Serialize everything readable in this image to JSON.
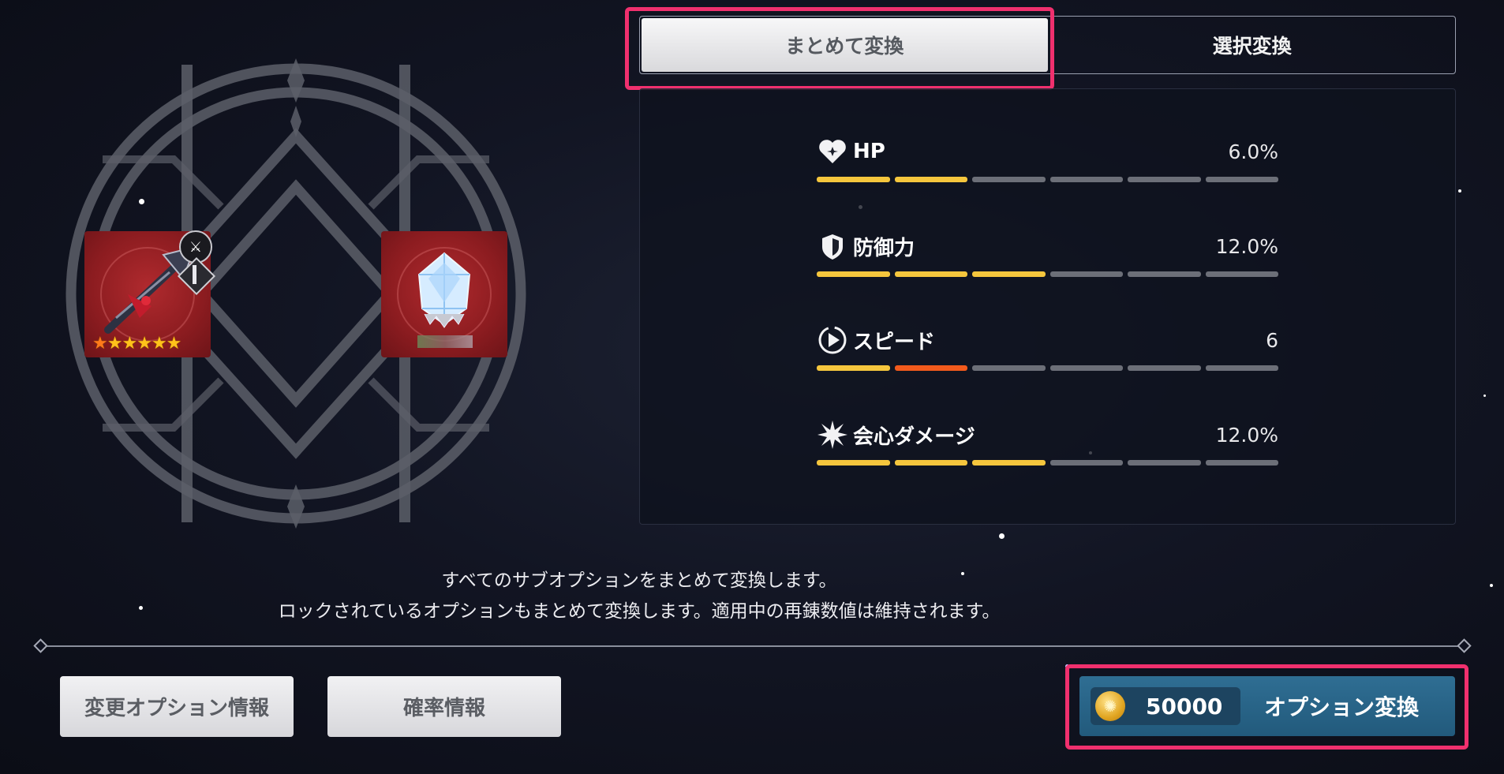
{
  "tabs": [
    {
      "label": "まとめて変換",
      "active": true
    },
    {
      "label": "選択変換",
      "active": false
    }
  ],
  "stats": [
    {
      "icon": "heart-icon",
      "name": "HP",
      "value": "6.0%",
      "bars": [
        "yellow",
        "yellow",
        "grey",
        "grey",
        "grey",
        "grey"
      ]
    },
    {
      "icon": "shield-icon",
      "name": "防御力",
      "value": "12.0%",
      "bars": [
        "yellow",
        "yellow",
        "yellow",
        "grey",
        "grey",
        "grey"
      ]
    },
    {
      "icon": "play-icon",
      "name": "スピード",
      "value": "6",
      "bars": [
        "yellow",
        "orange",
        "grey",
        "grey",
        "grey",
        "grey"
      ]
    },
    {
      "icon": "burst-icon",
      "name": "会心ダメージ",
      "value": "12.0%",
      "bars": [
        "yellow",
        "yellow",
        "yellow",
        "grey",
        "grey",
        "grey"
      ]
    }
  ],
  "equipment": {
    "weapon": {
      "icon": "spear-weapon-icon",
      "stars": 6
    },
    "material": {
      "icon": "crystal-icon"
    }
  },
  "description": {
    "line1": "すべてのサブオプションをまとめて変換します。",
    "line2": "ロックされているオプションもまとめて変換します。適用中の再錬数値は維持されます。"
  },
  "buttons": {
    "option_info": "変更オプション情報",
    "probability_info": "確率情報",
    "convert_cost": "50000",
    "convert_label": "オプション変換"
  },
  "colors": {
    "highlight": "#f0306e",
    "bar_yellow": "#f5c63d",
    "bar_orange": "#f25a1c",
    "bar_grey": "#6c6f78",
    "primary_button": "#2a6589"
  }
}
